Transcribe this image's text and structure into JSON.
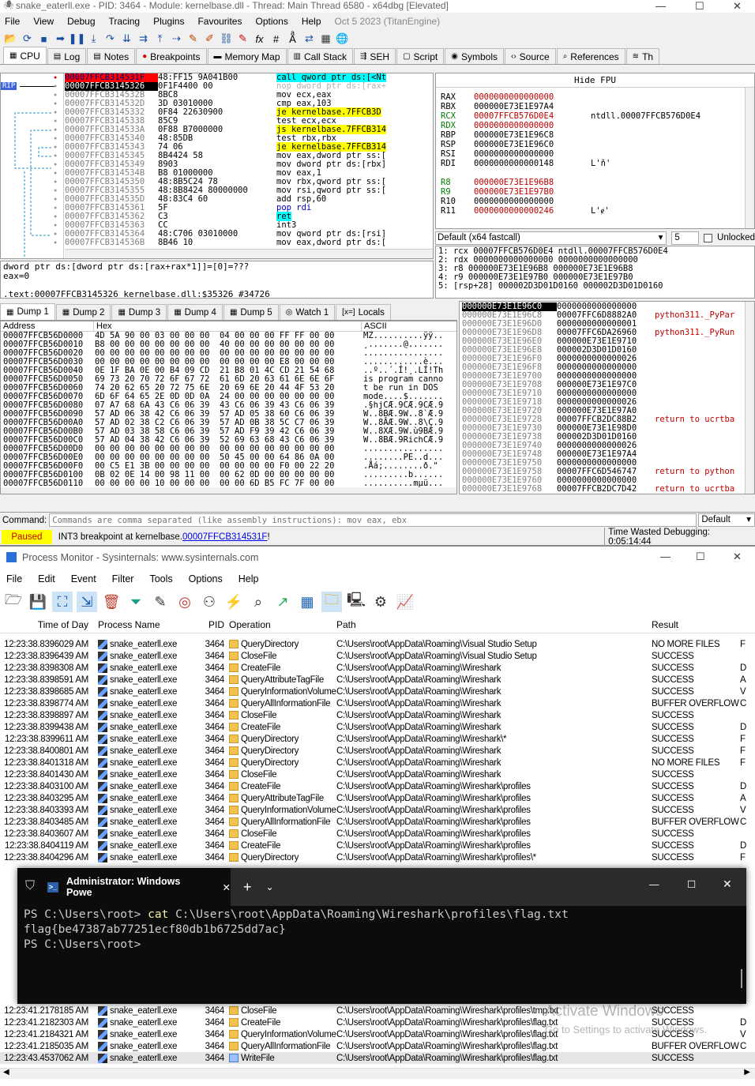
{
  "x64dbg": {
    "title": "snake_eaterll.exe - PID: 3464 - Module: kernelbase.dll - Thread: Main Thread 6580 - x64dbg [Elevated]",
    "menu": [
      "File",
      "View",
      "Debug",
      "Tracing",
      "Plugins",
      "Favourites",
      "Options",
      "Help"
    ],
    "build": "Oct 5 2023 (TitanEngine)",
    "tabs": [
      "CPU",
      "Log",
      "Notes",
      "Breakpoints",
      "Memory Map",
      "Call Stack",
      "SEH",
      "Script",
      "Symbols",
      "Source",
      "References",
      "Th"
    ],
    "disasm": {
      "rip_label": "RIP",
      "rows": [
        {
          "addr": "00007FFCB314531F",
          "bytes": "48:FF15 9A041B00",
          "instr": "call qword ptr ds:[<Nt"
        },
        {
          "addr": "00007FFCB3145326",
          "bytes": "0F1F4400 00",
          "instr": "nop dword ptr ds:[rax+"
        },
        {
          "addr": "00007FFCB314532B",
          "bytes": "8BC8",
          "instr": "mov ecx,eax"
        },
        {
          "addr": "00007FFCB314532D",
          "bytes": "3D 03010000",
          "instr": "cmp eax,103"
        },
        {
          "addr": "00007FFCB3145332",
          "bytes": "0F84 22630900",
          "instr": "je kernelbase.7FFCB3D"
        },
        {
          "addr": "00007FFCB3145338",
          "bytes": "85C9",
          "instr": "test ecx,ecx"
        },
        {
          "addr": "00007FFCB314533A",
          "bytes": "0F88 B7000000",
          "instr": "js kernelbase.7FFCB314"
        },
        {
          "addr": "00007FFCB3145340",
          "bytes": "48:85DB",
          "instr": "test rbx,rbx"
        },
        {
          "addr": "00007FFCB3145343",
          "bytes": "74 06",
          "instr": "je kernelbase.7FFCB314"
        },
        {
          "addr": "00007FFCB3145345",
          "bytes": "8B4424 58",
          "instr": "mov eax,dword ptr ss:["
        },
        {
          "addr": "00007FFCB3145349",
          "bytes": "8903",
          "instr": "mov dword ptr ds:[rbx]"
        },
        {
          "addr": "00007FFCB314534B",
          "bytes": "B8 01000000",
          "instr": "mov eax,1"
        },
        {
          "addr": "00007FFCB3145350",
          "bytes": "48:8B5C24 78",
          "instr": "mov rbx,qword ptr ss:["
        },
        {
          "addr": "00007FFCB3145355",
          "bytes": "48:8B8424 80000000",
          "instr": "mov rsi,qword ptr ss:["
        },
        {
          "addr": "00007FFCB314535D",
          "bytes": "48:83C4 60",
          "instr": "add rsp,60"
        },
        {
          "addr": "00007FFCB3145361",
          "bytes": "5F",
          "instr": "pop rdi"
        },
        {
          "addr": "00007FFCB3145362",
          "bytes": "C3",
          "instr": "ret"
        },
        {
          "addr": "00007FFCB3145363",
          "bytes": "CC",
          "instr": "int3"
        },
        {
          "addr": "00007FFCB3145364",
          "bytes": "48:C706 03010000",
          "instr": "mov qword ptr ds:[rsi]"
        },
        {
          "addr": "00007FFCB314536B",
          "bytes": "8B46 10",
          "instr": "mov eax,dword ptr ds:["
        }
      ],
      "info_line1": "dword ptr ds:[dword ptr ds:[rax+rax*1]]=[0]=???",
      "info_line2": "eax=0",
      "info_line3": ".text:00007FFCB3145326 kernelbase.dll:$35326 #34726"
    },
    "registers": {
      "header": "Hide FPU",
      "rows": [
        {
          "name": "RAX",
          "value": "0000000000000000",
          "note": ""
        },
        {
          "name": "RBX",
          "value": "000000E73E1E97A4",
          "note": ""
        },
        {
          "name": "RCX",
          "value": "00007FFCB576D0E4",
          "note": "ntdll.00007FFCB576D0E4"
        },
        {
          "name": "RDX",
          "value": "0000000000000000",
          "note": ""
        },
        {
          "name": "RBP",
          "value": "000000E73E1E96C8",
          "note": ""
        },
        {
          "name": "RSP",
          "value": "000000E73E1E96C0",
          "note": ""
        },
        {
          "name": "RSI",
          "value": "0000000000000000",
          "note": ""
        },
        {
          "name": "RDI",
          "value": "0000000000000148",
          "note": "L'ň'"
        },
        {
          "name": "",
          "value": "",
          "note": ""
        },
        {
          "name": "R8",
          "value": "000000E73E1E96B8",
          "note": ""
        },
        {
          "name": "R9",
          "value": "000000E73E1E97B0",
          "note": ""
        },
        {
          "name": "R10",
          "value": "0000000000000000",
          "note": ""
        },
        {
          "name": "R11",
          "value": "0000000000000246",
          "note": "L'ɇ'"
        }
      ],
      "callconv": "Default (x64 fastcall)",
      "argcount": "5",
      "unlocked": "Unlocked",
      "args": [
        "1: rcx 00007FFCB576D0E4 ntdll.00007FFCB576D0E4",
        "2: rdx 0000000000000000 0000000000000000",
        "3: r8 000000E73E1E96B8 000000E73E1E96B8",
        "4: r9 000000E73E1E97B0 000000E73E1E97B0",
        "5: [rsp+28] 000002D3D01D0160 000002D3D01D0160"
      ]
    },
    "dump_tabs": [
      "Dump 1",
      "Dump 2",
      "Dump 3",
      "Dump 4",
      "Dump 5",
      "Watch 1",
      "Locals"
    ],
    "dump": {
      "headers": [
        "Address",
        "Hex",
        "ASCII"
      ],
      "rows": [
        {
          "addr": "00007FFCB56D0000",
          "hex": "4D 5A 90 00 03 00 00 00  04 00 00 00 FF FF 00 00",
          "ascii": "MZ..........ÿÿ.."
        },
        {
          "addr": "00007FFCB56D0010",
          "hex": "B8 00 00 00 00 00 00 00  40 00 00 00 00 00 00 00",
          "ascii": "¸.......@......."
        },
        {
          "addr": "00007FFCB56D0020",
          "hex": "00 00 00 00 00 00 00 00  00 00 00 00 00 00 00 00",
          "ascii": "................"
        },
        {
          "addr": "00007FFCB56D0030",
          "hex": "00 00 00 00 00 00 00 00  00 00 00 00 E8 00 00 00",
          "ascii": "............è..."
        },
        {
          "addr": "00007FFCB56D0040",
          "hex": "0E 1F BA 0E 00 B4 09 CD  21 B8 01 4C CD 21 54 68",
          "ascii": "..º..´.Í!¸.LÍ!Th"
        },
        {
          "addr": "00007FFCB56D0050",
          "hex": "69 73 20 70 72 6F 67 72  61 6D 20 63 61 6E 6E 6F",
          "ascii": "is program canno"
        },
        {
          "addr": "00007FFCB56D0060",
          "hex": "74 20 62 65 20 72 75 6E  20 69 6E 20 44 4F 53 20",
          "ascii": "t be run in DOS "
        },
        {
          "addr": "00007FFCB56D0070",
          "hex": "6D 6F 64 65 2E 0D 0D 0A  24 00 00 00 00 00 00 00",
          "ascii": "mode....$......."
        },
        {
          "addr": "00007FFCB56D0080",
          "hex": "07 A7 68 6A 43 C6 06 39  43 C6 06 39 43 C6 06 39",
          "ascii": ".§hjCÆ.9CÆ.9CÆ.9"
        },
        {
          "addr": "00007FFCB56D0090",
          "hex": "57 AD 06 38 42 C6 06 39  57 AD 05 38 60 C6 06 39",
          "ascii": "W..8BÆ.9W..8`Æ.9"
        },
        {
          "addr": "00007FFCB56D00A0",
          "hex": "57 AD 02 38 C2 C6 06 39  57 AD 0B 38 5C C7 06 39",
          "ascii": "W..8ÂÆ.9W..8\\Ç.9"
        },
        {
          "addr": "00007FFCB56D00B0",
          "hex": "57 AD 03 38 58 C6 06 39  57 AD F9 39 42 C6 06 39",
          "ascii": "W..8XÆ.9W.ù9BÆ.9"
        },
        {
          "addr": "00007FFCB56D00C0",
          "hex": "57 AD 04 38 42 C6 06 39  52 69 63 68 43 C6 06 39",
          "ascii": "W..8BÆ.9RichCÆ.9"
        },
        {
          "addr": "00007FFCB56D00D0",
          "hex": "00 00 00 00 00 00 00 00  00 00 00 00 00 00 00 00",
          "ascii": "................"
        },
        {
          "addr": "00007FFCB56D00E0",
          "hex": "00 00 00 00 00 00 00 00  50 45 00 00 64 86 0A 00",
          "ascii": "........PE..d..."
        },
        {
          "addr": "00007FFCB56D00F0",
          "hex": "00 C5 E1 3B 00 00 00 00  00 00 00 00 F0 00 22 20",
          "ascii": ".Åá;........ð.\" "
        },
        {
          "addr": "00007FFCB56D0100",
          "hex": "0B 02 0E 14 00 98 11 00  00 62 0D 00 00 00 00 00",
          "ascii": ".........b......"
        },
        {
          "addr": "00007FFCB56D0110",
          "hex": "00 00 00 00 10 00 00 00  00 00 6D B5 FC 7F 00 00",
          "ascii": "..........mµü..."
        }
      ]
    },
    "stack": {
      "rows": [
        {
          "addr": "000000E73E1E96C0",
          "val": "0000000000000000",
          "note": ""
        },
        {
          "addr": "000000E73E1E96C8",
          "val": "00007FFC6D8882A0",
          "note": "python311._PyPar"
        },
        {
          "addr": "000000E73E1E96D0",
          "val": "0000000000000001",
          "note": ""
        },
        {
          "addr": "000000E73E1E96D8",
          "val": "00007FFC6DA26960",
          "note": "python311._PyRun"
        },
        {
          "addr": "000000E73E1E96E0",
          "val": "000000E73E1E9710",
          "note": ""
        },
        {
          "addr": "000000E73E1E96E8",
          "val": "000002D3D01D0160",
          "note": ""
        },
        {
          "addr": "000000E73E1E96F0",
          "val": "0000000000000026",
          "note": ""
        },
        {
          "addr": "000000E73E1E96F8",
          "val": "0000000000000000",
          "note": ""
        },
        {
          "addr": "000000E73E1E9700",
          "val": "0000000000000000",
          "note": ""
        },
        {
          "addr": "000000E73E1E9708",
          "val": "000000E73E1E97C0",
          "note": ""
        },
        {
          "addr": "000000E73E1E9710",
          "val": "0000000000000000",
          "note": ""
        },
        {
          "addr": "000000E73E1E9718",
          "val": "0000000000000026",
          "note": ""
        },
        {
          "addr": "000000E73E1E9720",
          "val": "000000E73E1E97A0",
          "note": ""
        },
        {
          "addr": "000000E73E1E9728",
          "val": "00007FFCB2DC88B2",
          "note": "return to ucrtba"
        },
        {
          "addr": "000000E73E1E9730",
          "val": "000000E73E1E98D0",
          "note": ""
        },
        {
          "addr": "000000E73E1E9738",
          "val": "000002D3D01D0160",
          "note": ""
        },
        {
          "addr": "000000E73E1E9740",
          "val": "0000000000000026",
          "note": ""
        },
        {
          "addr": "000000E73E1E9748",
          "val": "000000E73E1E97A4",
          "note": ""
        },
        {
          "addr": "000000E73E1E9750",
          "val": "0000000000000000",
          "note": ""
        },
        {
          "addr": "000000E73E1E9758",
          "val": "00007FFC6D546747",
          "note": "return to python"
        },
        {
          "addr": "000000E73E1E9760",
          "val": "0000000000000000",
          "note": ""
        },
        {
          "addr": "000000E73E1E9768",
          "val": "00007FFCB2DC7D42",
          "note": "return to ucrtba"
        }
      ]
    },
    "command_label": "Command:",
    "command_placeholder": "Commands are comma separated (like assembly instructions): mov eax, ebx",
    "command_mode": "Default",
    "status": {
      "state": "Paused",
      "message_prefix": "INT3 breakpoint at kernelbase.",
      "message_link": "00007FFCB314531F",
      "message_suffix": "!",
      "time": "Time Wasted Debugging: 0:05:14:44"
    }
  },
  "procmon": {
    "title": "Process Monitor - Sysinternals: www.sysinternals.com",
    "menu": [
      "File",
      "Edit",
      "Event",
      "Filter",
      "Tools",
      "Options",
      "Help"
    ],
    "columns": [
      "Time of Day",
      "Process Name",
      "PID",
      "Operation",
      "Path",
      "Result",
      "Detail"
    ],
    "rows": [
      {
        "time": "12:23:38.8396029 AM",
        "proc": "snake_eaterll.exe",
        "pid": "3464",
        "op": "QueryDirectory",
        "path": "C:\\Users\\root\\AppData\\Roaming\\Visual Studio Setup",
        "res": "NO MORE FILES",
        "det": "F"
      },
      {
        "time": "12:23:38.8396439 AM",
        "proc": "snake_eaterll.exe",
        "pid": "3464",
        "op": "CloseFile",
        "path": "C:\\Users\\root\\AppData\\Roaming\\Visual Studio Setup",
        "res": "SUCCESS",
        "det": ""
      },
      {
        "time": "12:23:38.8398308 AM",
        "proc": "snake_eaterll.exe",
        "pid": "3464",
        "op": "CreateFile",
        "path": "C:\\Users\\root\\AppData\\Roaming\\Wireshark",
        "res": "SUCCESS",
        "det": "D"
      },
      {
        "time": "12:23:38.8398591 AM",
        "proc": "snake_eaterll.exe",
        "pid": "3464",
        "op": "QueryAttributeTagFile",
        "path": "C:\\Users\\root\\AppData\\Roaming\\Wireshark",
        "res": "SUCCESS",
        "det": "A"
      },
      {
        "time": "12:23:38.8398685 AM",
        "proc": "snake_eaterll.exe",
        "pid": "3464",
        "op": "QueryInformationVolume",
        "path": "C:\\Users\\root\\AppData\\Roaming\\Wireshark",
        "res": "SUCCESS",
        "det": "V"
      },
      {
        "time": "12:23:38.8398774 AM",
        "proc": "snake_eaterll.exe",
        "pid": "3464",
        "op": "QueryAllInformationFile",
        "path": "C:\\Users\\root\\AppData\\Roaming\\Wireshark",
        "res": "BUFFER OVERFLOW",
        "det": "C"
      },
      {
        "time": "12:23:38.8398897 AM",
        "proc": "snake_eaterll.exe",
        "pid": "3464",
        "op": "CloseFile",
        "path": "C:\\Users\\root\\AppData\\Roaming\\Wireshark",
        "res": "SUCCESS",
        "det": ""
      },
      {
        "time": "12:23:38.8399438 AM",
        "proc": "snake_eaterll.exe",
        "pid": "3464",
        "op": "CreateFile",
        "path": "C:\\Users\\root\\AppData\\Roaming\\Wireshark",
        "res": "SUCCESS",
        "det": "D"
      },
      {
        "time": "12:23:38.8399611 AM",
        "proc": "snake_eaterll.exe",
        "pid": "3464",
        "op": "QueryDirectory",
        "path": "C:\\Users\\root\\AppData\\Roaming\\Wireshark\\*",
        "res": "SUCCESS",
        "det": "F"
      },
      {
        "time": "12:23:38.8400801 AM",
        "proc": "snake_eaterll.exe",
        "pid": "3464",
        "op": "QueryDirectory",
        "path": "C:\\Users\\root\\AppData\\Roaming\\Wireshark",
        "res": "SUCCESS",
        "det": "F"
      },
      {
        "time": "12:23:38.8401318 AM",
        "proc": "snake_eaterll.exe",
        "pid": "3464",
        "op": "QueryDirectory",
        "path": "C:\\Users\\root\\AppData\\Roaming\\Wireshark",
        "res": "NO MORE FILES",
        "det": "F"
      },
      {
        "time": "12:23:38.8401430 AM",
        "proc": "snake_eaterll.exe",
        "pid": "3464",
        "op": "CloseFile",
        "path": "C:\\Users\\root\\AppData\\Roaming\\Wireshark",
        "res": "SUCCESS",
        "det": ""
      },
      {
        "time": "12:23:38.8403100 AM",
        "proc": "snake_eaterll.exe",
        "pid": "3464",
        "op": "CreateFile",
        "path": "C:\\Users\\root\\AppData\\Roaming\\Wireshark\\profiles",
        "res": "SUCCESS",
        "det": "D"
      },
      {
        "time": "12:23:38.8403295 AM",
        "proc": "snake_eaterll.exe",
        "pid": "3464",
        "op": "QueryAttributeTagFile",
        "path": "C:\\Users\\root\\AppData\\Roaming\\Wireshark\\profiles",
        "res": "SUCCESS",
        "det": "A"
      },
      {
        "time": "12:23:38.8403393 AM",
        "proc": "snake_eaterll.exe",
        "pid": "3464",
        "op": "QueryInformationVolume",
        "path": "C:\\Users\\root\\AppData\\Roaming\\Wireshark\\profiles",
        "res": "SUCCESS",
        "det": "V"
      },
      {
        "time": "12:23:38.8403485 AM",
        "proc": "snake_eaterll.exe",
        "pid": "3464",
        "op": "QueryAllInformationFile",
        "path": "C:\\Users\\root\\AppData\\Roaming\\Wireshark\\profiles",
        "res": "BUFFER OVERFLOW",
        "det": "C"
      },
      {
        "time": "12:23:38.8403607 AM",
        "proc": "snake_eaterll.exe",
        "pid": "3464",
        "op": "CloseFile",
        "path": "C:\\Users\\root\\AppData\\Roaming\\Wireshark\\profiles",
        "res": "SUCCESS",
        "det": ""
      },
      {
        "time": "12:23:38.8404119 AM",
        "proc": "snake_eaterll.exe",
        "pid": "3464",
        "op": "CreateFile",
        "path": "C:\\Users\\root\\AppData\\Roaming\\Wireshark\\profiles",
        "res": "SUCCESS",
        "det": "D"
      },
      {
        "time": "12:23:38.8404296 AM",
        "proc": "snake_eaterll.exe",
        "pid": "3464",
        "op": "QueryDirectory",
        "path": "C:\\Users\\root\\AppData\\Roaming\\Wireshark\\profiles\\*",
        "res": "SUCCESS",
        "det": "F"
      }
    ],
    "rows_bottom": [
      {
        "time": "12:23:41.2178185 AM",
        "proc": "snake_eaterll.exe",
        "pid": "3464",
        "op": "CloseFile",
        "path": "C:\\Users\\root\\AppData\\Roaming\\Wireshark\\profiles\\tmp.txt",
        "res": "SUCCESS",
        "det": ""
      },
      {
        "time": "12:23:41.2182303 AM",
        "proc": "snake_eaterll.exe",
        "pid": "3464",
        "op": "CreateFile",
        "path": "C:\\Users\\root\\AppData\\Roaming\\Wireshark\\profiles\\flag.txt",
        "res": "SUCCESS",
        "det": "D"
      },
      {
        "time": "12:23:41.2184321 AM",
        "proc": "snake_eaterll.exe",
        "pid": "3464",
        "op": "QueryInformationVolume",
        "path": "C:\\Users\\root\\AppData\\Roaming\\Wireshark\\profiles\\flag.txt",
        "res": "SUCCESS",
        "det": "V"
      },
      {
        "time": "12:23:41.2185035 AM",
        "proc": "snake_eaterll.exe",
        "pid": "3464",
        "op": "QueryAllInformationFile",
        "path": "C:\\Users\\root\\AppData\\Roaming\\Wireshark\\profiles\\flag.txt",
        "res": "BUFFER OVERFLOW",
        "det": "C"
      },
      {
        "time": "12:23:43.4537062 AM",
        "proc": "snake_eaterll.exe",
        "pid": "3464",
        "op": "WriteFile",
        "path": "C:\\Users\\root\\AppData\\Roaming\\Wireshark\\profiles\\flag.txt",
        "res": "SUCCESS",
        "det": ""
      }
    ],
    "watermark1": "Activate Windows",
    "watermark2": "Go to Settings to activate Windows."
  },
  "powershell": {
    "tab_title": "Administrator: Windows Powe",
    "line1_prompt": "PS C:\\Users\\root> ",
    "line1_cmd": "cat",
    "line1_arg": " C:\\Users\\root\\AppData\\Roaming\\Wireshark\\profiles\\flag.txt",
    "line2": "flag{be47387ab77251ecf80db1b6725dd7ac}",
    "line3": "PS C:\\Users\\root>"
  },
  "colors": {
    "accent": "#0000c0",
    "rip": "#ff0000",
    "paused": "#ffff00",
    "ps_bg": "#0c0c0c"
  }
}
